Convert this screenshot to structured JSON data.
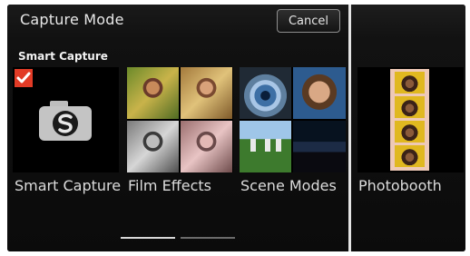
{
  "header": {
    "title": "Capture Mode",
    "cancel_label": "Cancel"
  },
  "section": {
    "label": "Smart Capture"
  },
  "modes": [
    {
      "label": "Smart Capture",
      "selected": true,
      "icon": "camera-s-icon"
    },
    {
      "label": "Film Effects"
    },
    {
      "label": "Scene Modes"
    },
    {
      "label": "Photobooth"
    }
  ],
  "pager": {
    "pages": 2,
    "current": 1
  },
  "colors": {
    "background": "#0b0b0b",
    "check_badge": "#e23b26",
    "text": "#dcdcdc"
  }
}
